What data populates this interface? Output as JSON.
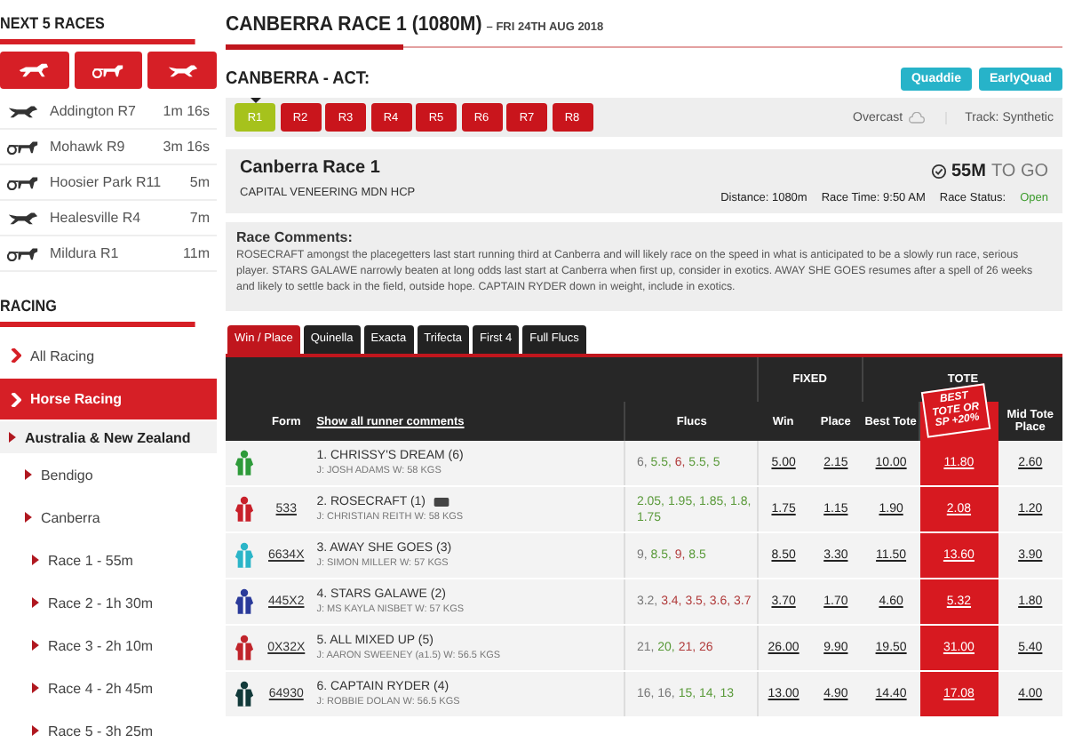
{
  "next_races": {
    "title": "NEXT 5 RACES",
    "filters": [
      {
        "kind": "gallops"
      },
      {
        "kind": "harness"
      },
      {
        "kind": "greyhounds"
      }
    ],
    "races": [
      {
        "kind": "greyhounds",
        "name": "Addington R7",
        "time": "1m 16s"
      },
      {
        "kind": "harness",
        "name": "Mohawk R9",
        "time": "3m 16s"
      },
      {
        "kind": "harness",
        "name": "Hoosier Park R11",
        "time": "5m"
      },
      {
        "kind": "greyhounds",
        "name": "Healesville R4",
        "time": "7m"
      },
      {
        "kind": "harness",
        "name": "Mildura R1",
        "time": "11m"
      }
    ]
  },
  "racing": {
    "title": "RACING",
    "items": [
      {
        "label": "All Racing",
        "selected": false
      },
      {
        "label": "Horse Racing",
        "selected": true,
        "children": [
          {
            "label": "Australia & New Zealand",
            "selected": false,
            "children": [
              {
                "label": "Bendigo",
                "selected": false
              },
              {
                "label": "Canberra",
                "selected": false,
                "children": [
                  {
                    "label": "Race 1 - 55m",
                    "selected": false
                  },
                  {
                    "label": "Race 2 - 1h 30m",
                    "selected": false
                  },
                  {
                    "label": "Race 3 - 2h 10m",
                    "selected": false
                  },
                  {
                    "label": "Race 4 - 2h 45m",
                    "selected": false
                  },
                  {
                    "label": "Race 5 - 3h 25m",
                    "selected": false
                  }
                ]
              }
            ]
          }
        ]
      }
    ]
  },
  "page": {
    "title": "CANBERRA RACE 1 (1080M)",
    "separator": "–",
    "date": "FRI 24TH AUG 2018"
  },
  "meeting": {
    "name": "CANBERRA - ACT:",
    "bet_buttons": [
      "Quaddie",
      "EarlyQuad"
    ],
    "races": [
      {
        "label": "R1",
        "selected": true
      },
      {
        "label": "R2",
        "selected": false
      },
      {
        "label": "R3",
        "selected": false
      },
      {
        "label": "R4",
        "selected": false
      },
      {
        "label": "R5",
        "selected": false
      },
      {
        "label": "R6",
        "selected": false
      },
      {
        "label": "R7",
        "selected": false
      },
      {
        "label": "R8",
        "selected": false
      }
    ],
    "weather": "Overcast",
    "track": "Track: Synthetic"
  },
  "race": {
    "name": "Canberra Race 1",
    "class": "CAPITAL VENEERING MDN HCP",
    "countdown": "55M",
    "countdown_suffix": "TO GO",
    "distance": "Distance: 1080m",
    "time": "Race Time: 9:50 AM",
    "status_label": "Race Status:",
    "status": "Open"
  },
  "comments": {
    "title": "Race Comments:",
    "text": "ROSECRAFT amongst the placegetters last start running third at Canberra and will likely race on the speed in what is anticipated to be a slowly run race, serious player. STARS GALAWE narrowly beaten at long odds last start at Canberra when first up, consider in exotics. AWAY SHE GOES resumes after a spell of 26 weeks and likely to settle back in the field, outside hope. CAPTAIN RYDER down in weight, include in exotics."
  },
  "tabs": [
    {
      "label": "Win / Place",
      "selected": true
    },
    {
      "label": "Quinella",
      "selected": false
    },
    {
      "label": "Exacta",
      "selected": false
    },
    {
      "label": "Trifecta",
      "selected": false
    },
    {
      "label": "First 4",
      "selected": false
    },
    {
      "label": "Full Flucs",
      "selected": false
    }
  ],
  "table": {
    "group_headers": [
      "FIXED",
      "TOTE"
    ],
    "columns": [
      "Form",
      "Show all runner comments",
      "Flucs",
      "Win",
      "Place",
      "Best Tote",
      "BEST TOTE OR SP +20%",
      "Mid Tote Place"
    ],
    "runners": [
      {
        "color": "#2e9b3a",
        "name": "1. CHRISSY'S DREAM (6)",
        "gear_badge": false,
        "jockey": "J: JOSH ADAMS  W: 58 KGS",
        "flucs": [
          {
            "value": "6,",
            "color": "#777777"
          },
          {
            "value": "5.5,",
            "color": "#5a9a3a"
          },
          {
            "value": "6,",
            "color": "#b03a3a"
          },
          {
            "value": "5.5,",
            "color": "#5a9a3a"
          },
          {
            "value": "5",
            "color": "#5a9a3a"
          }
        ],
        "odds": [
          "5.00",
          "2.15",
          "10.00",
          "11.80",
          "2.60"
        ]
      },
      {
        "color": "#c8202a",
        "form": "533",
        "name": "2. ROSECRAFT (1)",
        "gear_badge": true,
        "jockey": "J: CHRISTIAN REITH  W: 58 KGS",
        "flucs": [
          {
            "value": "2.05,",
            "color": "#5a9a3a"
          },
          {
            "value": "1.95,",
            "color": "#5a9a3a"
          },
          {
            "value": "1.85,",
            "color": "#5a9a3a"
          },
          {
            "value": "1.8,",
            "color": "#5a9a3a"
          },
          {
            "value": "1.75",
            "color": "#5a9a3a"
          }
        ],
        "odds": [
          "1.75",
          "1.15",
          "1.90",
          "2.08",
          "1.20"
        ]
      },
      {
        "color": "#2bb5c8",
        "form": "6634X",
        "name": "3. AWAY SHE GOES (3)",
        "gear_badge": false,
        "jockey": "J: SIMON MILLER  W: 57 KGS",
        "flucs": [
          {
            "value": "9,",
            "color": "#777777"
          },
          {
            "value": "8.5,",
            "color": "#5a9a3a"
          },
          {
            "value": "9,",
            "color": "#b03a3a"
          },
          {
            "value": "8.5",
            "color": "#5a9a3a"
          }
        ],
        "odds": [
          "8.50",
          "3.30",
          "11.50",
          "13.60",
          "3.90"
        ]
      },
      {
        "color": "#2a3a9a",
        "form": "445X2",
        "name": "4. STARS GALAWE (2)",
        "gear_badge": false,
        "jockey": "J: MS KAYLA NISBET  W: 57 KGS",
        "flucs": [
          {
            "value": "3.2,",
            "color": "#777777"
          },
          {
            "value": "3.4,",
            "color": "#b03a3a"
          },
          {
            "value": "3.5,",
            "color": "#b03a3a"
          },
          {
            "value": "3.6,",
            "color": "#b03a3a"
          },
          {
            "value": "3.7",
            "color": "#b03a3a"
          }
        ],
        "odds": [
          "3.70",
          "1.70",
          "4.60",
          "5.32",
          "1.80"
        ]
      },
      {
        "color": "#c0242b",
        "form": "0X32X",
        "name": "5. ALL MIXED UP (5)",
        "gear_badge": false,
        "jockey": "J: AARON SWEENEY (a1.5)  W: 56.5 KGS",
        "flucs": [
          {
            "value": "21,",
            "color": "#777777"
          },
          {
            "value": "20,",
            "color": "#5a9a3a"
          },
          {
            "value": "21,",
            "color": "#b03a3a"
          },
          {
            "value": "26",
            "color": "#b03a3a"
          }
        ],
        "odds": [
          "26.00",
          "9.90",
          "19.50",
          "31.00",
          "5.40"
        ]
      },
      {
        "color": "#123a3a",
        "form": "64930",
        "name": "6. CAPTAIN RYDER (4)",
        "gear_badge": false,
        "jockey": "J: ROBBIE DOLAN  W: 56.5 KGS",
        "flucs": [
          {
            "value": "16,",
            "color": "#777777"
          },
          {
            "value": "16,",
            "color": "#777777"
          },
          {
            "value": "15,",
            "color": "#5a9a3a"
          },
          {
            "value": "14,",
            "color": "#5a9a3a"
          },
          {
            "value": "13",
            "color": "#5a9a3a"
          }
        ],
        "odds": [
          "13.00",
          "4.90",
          "14.40",
          "17.08",
          "4.00"
        ]
      }
    ]
  }
}
